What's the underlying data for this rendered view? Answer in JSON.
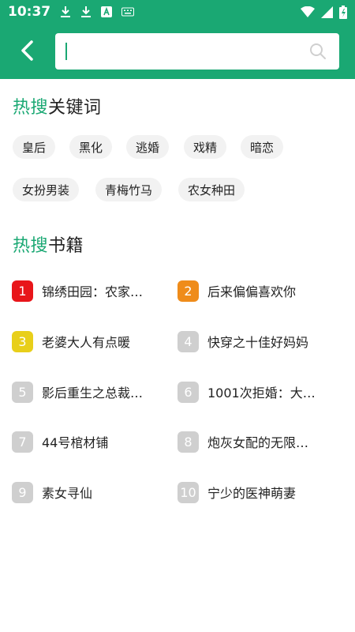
{
  "status_bar": {
    "time": "10:37",
    "left_icons": [
      "download-icon",
      "download-icon",
      "font-app-icon",
      "keyboard-icon"
    ],
    "right_icons": [
      "wifi-icon",
      "signal-icon",
      "battery-icon"
    ]
  },
  "header": {
    "back_icon": "back-arrow-icon",
    "search": {
      "value": "",
      "placeholder": ""
    },
    "search_icon": "search-icon"
  },
  "colors": {
    "brand": "#1aa873",
    "rank_1": "#e8161a",
    "rank_2": "#ef8c1a",
    "rank_3": "#e8cf1a",
    "rank_other": "#cfcfcf",
    "tag_bg": "#f2f2f2"
  },
  "hot_keywords": {
    "title_accent": "热搜",
    "title_rest": "关键词",
    "tags": [
      "皇后",
      "黑化",
      "逃婚",
      "戏精",
      "暗恋",
      "女扮男装",
      "青梅竹马",
      "农女种田"
    ]
  },
  "hot_books": {
    "title_accent": "热搜",
    "title_rest": "书籍",
    "items": [
      {
        "rank": "1",
        "title": "锦绣田园：农家…"
      },
      {
        "rank": "2",
        "title": "后来偏偏喜欢你"
      },
      {
        "rank": "3",
        "title": "老婆大人有点暖"
      },
      {
        "rank": "4",
        "title": "快穿之十佳好妈妈"
      },
      {
        "rank": "5",
        "title": "影后重生之总裁…"
      },
      {
        "rank": "6",
        "title": "1001次拒婚：大…"
      },
      {
        "rank": "7",
        "title": "44号棺材铺"
      },
      {
        "rank": "8",
        "title": "炮灰女配的无限…"
      },
      {
        "rank": "9",
        "title": "素女寻仙"
      },
      {
        "rank": "10",
        "title": "宁少的医神萌妻"
      }
    ]
  }
}
